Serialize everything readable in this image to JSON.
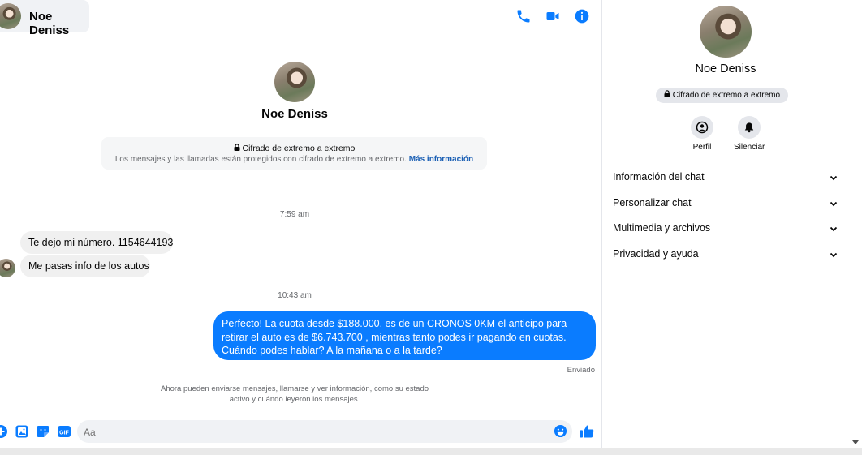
{
  "header": {
    "contact_name": "Noe Deniss",
    "icons": [
      "phone-icon",
      "video-camera-icon",
      "info-icon"
    ],
    "accent_color": "#0a7cff"
  },
  "intro": {
    "contact_name": "Noe Deniss",
    "encryption_title": "Cifrado de extremo a extremo",
    "encryption_text": "Los mensajes y las llamadas están protegidos con cifrado de extremo a extremo.",
    "more_info_link": "Más información"
  },
  "messages": {
    "time_1": "7:59 am",
    "incoming_1": "Te dejo mi número. 1154644193",
    "incoming_2": "Me pasas info de los autos",
    "time_2": "10:43 am",
    "outgoing_1": "Perfecto! La cuota desde $188.000. es de un CRONOS 0KM el anticipo para retirar el auto es de $6.743.700 , mientras tanto podes ir pagando en cuotas. Cuándo podes hablar? A la mañana o a la tarde?",
    "status": "Enviado",
    "notice": "Ahora pueden enviarse mensajes, llamarse y ver información, como su estado activo y cuándo leyeron los mensajes."
  },
  "composer": {
    "placeholder": "Aa",
    "icons": [
      "plus-icon",
      "image-icon",
      "sticker-icon",
      "gif-icon",
      "emoji-icon",
      "thumbs-up-icon"
    ],
    "gif_label": "GIF"
  },
  "sidebar": {
    "contact_name": "Noe Deniss",
    "encryption_badge": "Cifrado de extremo a extremo",
    "actions": [
      {
        "label": "Perfil",
        "icon": "profile-icon"
      },
      {
        "label": "Silenciar",
        "icon": "bell-icon"
      }
    ],
    "sections": [
      {
        "label": "Información del chat"
      },
      {
        "label": "Personalizar chat"
      },
      {
        "label": "Multimedia y archivos"
      },
      {
        "label": "Privacidad y ayuda"
      }
    ]
  }
}
